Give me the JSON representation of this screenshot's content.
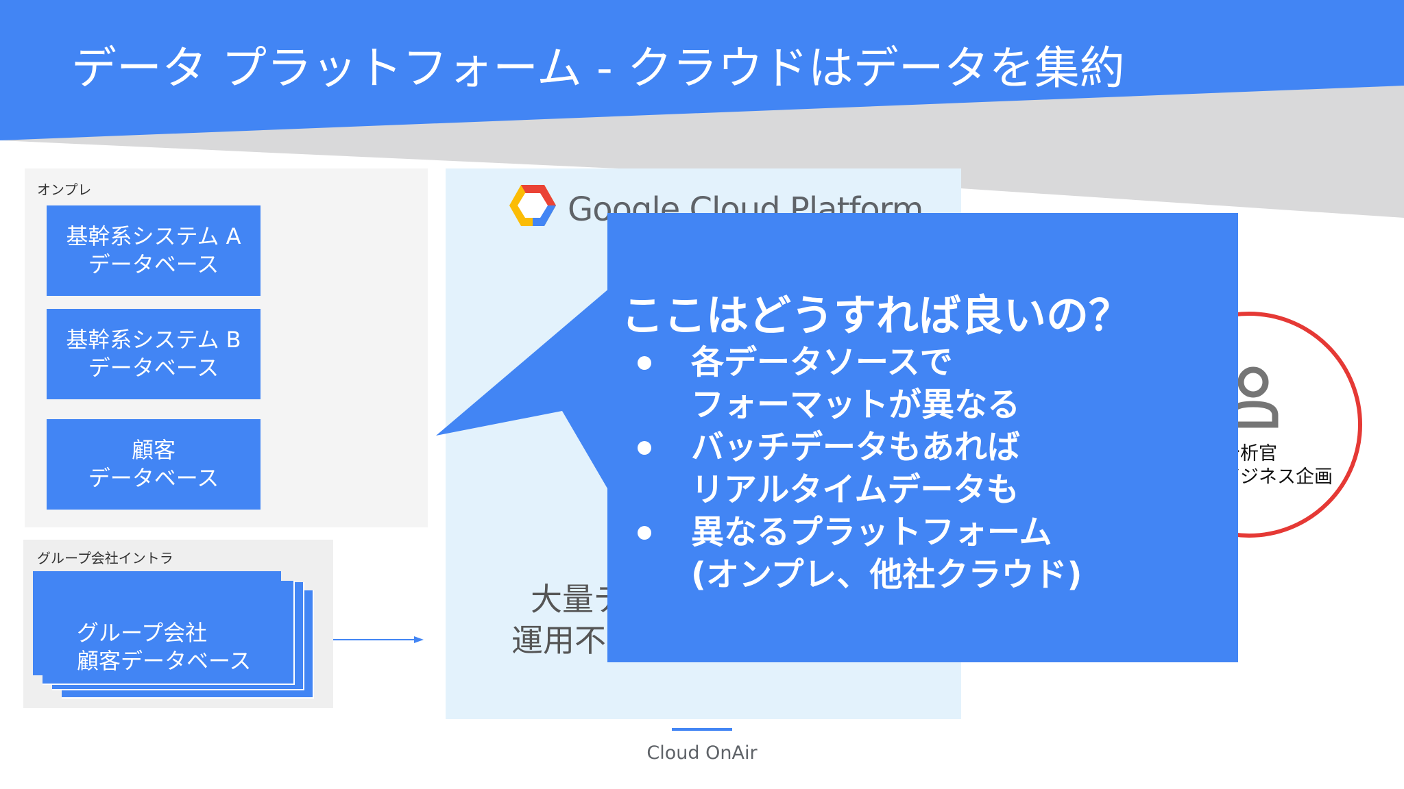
{
  "title": "データ プラットフォーム - クラウドはデータを集約",
  "colors": {
    "primary": "#4285f4",
    "gray_band": "#d9d9da",
    "gcp_panel": "#e3f2fc",
    "circle": "#e53935"
  },
  "onprem": {
    "label": "オンプレ",
    "systems": [
      {
        "line1": "基幹系システム A",
        "line2": "データベース"
      },
      {
        "line1": "基幹系システム B",
        "line2": "データベース"
      },
      {
        "line1": "顧客",
        "line2": "データベース"
      }
    ]
  },
  "group": {
    "label": "グループ会社イントラ",
    "box": {
      "line1": "グループ会社",
      "line2": "顧客データベース"
    }
  },
  "gcp": {
    "logo_icon": "google-cloud-hexagon-icon",
    "brand": "Google Cloud Platform",
    "bottom_line1": "大量デ",
    "bottom_line2": "運用不"
  },
  "callout": {
    "question": "ここはどうすれば良いの？",
    "bullets": [
      {
        "line1": "各データソースで",
        "line2": "フォーマットが異なる"
      },
      {
        "line1": "バッチデータもあれば",
        "line2": "リアルタイムデータも"
      },
      {
        "line1": "異なるプラットフォーム",
        "line2": "(オンプレ、他社クラウド)"
      }
    ]
  },
  "role": {
    "icon": "person-icon",
    "line1": "分析官",
    "line2": "ビジネス企画"
  },
  "footer": "Cloud OnAir"
}
